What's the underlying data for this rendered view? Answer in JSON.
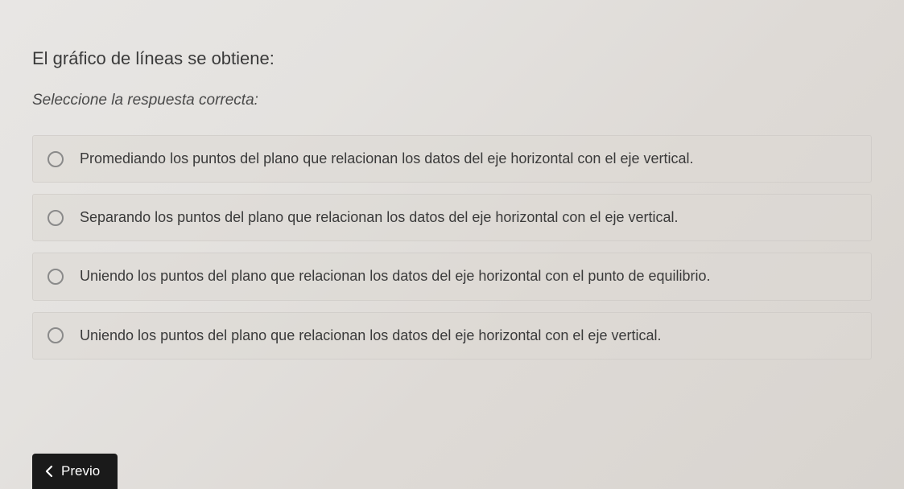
{
  "question": {
    "title": "El gráfico de líneas se obtiene:",
    "instruction": "Seleccione la respuesta correcta:"
  },
  "options": [
    {
      "label": "Promediando los puntos del plano que relacionan los datos del eje horizontal con el eje vertical."
    },
    {
      "label": "Separando los puntos del plano que relacionan los datos del eje horizontal con el eje vertical."
    },
    {
      "label": "Uniendo los puntos del plano que relacionan los datos del eje horizontal con el punto de equilibrio."
    },
    {
      "label": "Uniendo los puntos del plano que relacionan los datos del eje horizontal con el eje vertical."
    }
  ],
  "nav": {
    "prev_label": "Previo"
  }
}
